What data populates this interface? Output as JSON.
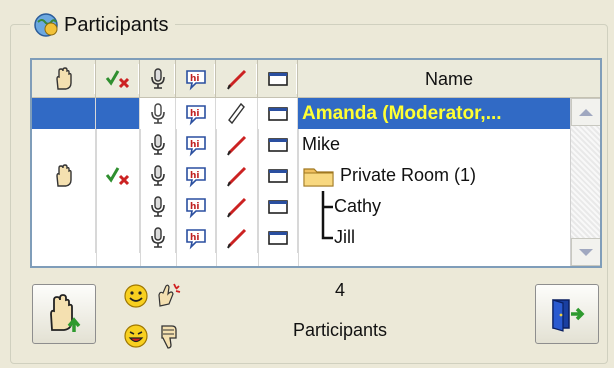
{
  "groupbox": {
    "title": "Participants",
    "icon": "participants-globe-icon"
  },
  "columns": {
    "hand": "hand-raise-icon",
    "vote": "yes-no-vote-icon",
    "mic": "microphone-icon",
    "chat": "chat-bubble-icon",
    "draw": "pencil-icon",
    "screen": "screen-icon",
    "name": "Name"
  },
  "rows": [
    {
      "name": "Amanda (Moderator,...",
      "selected": true
    },
    {
      "name": "Mike"
    },
    {
      "name": "Private Room (1)",
      "icon": "folder-icon"
    },
    {
      "name": "Cathy",
      "tree": "branch"
    },
    {
      "name": "Jill",
      "tree": "last"
    }
  ],
  "footer": {
    "count": "4",
    "count_label": "Participants",
    "raise_hand_button": "raise-hand-button",
    "exit_button": "exit-room-button",
    "emoticons": [
      "smile-icon",
      "applause-icon",
      "laugh-icon",
      "thumbs-down-icon"
    ]
  },
  "colors": {
    "selection": "#316AC5",
    "selected_text": "#FFFF33",
    "pencil": "#CC2222",
    "bg": "#ECE9D8"
  }
}
